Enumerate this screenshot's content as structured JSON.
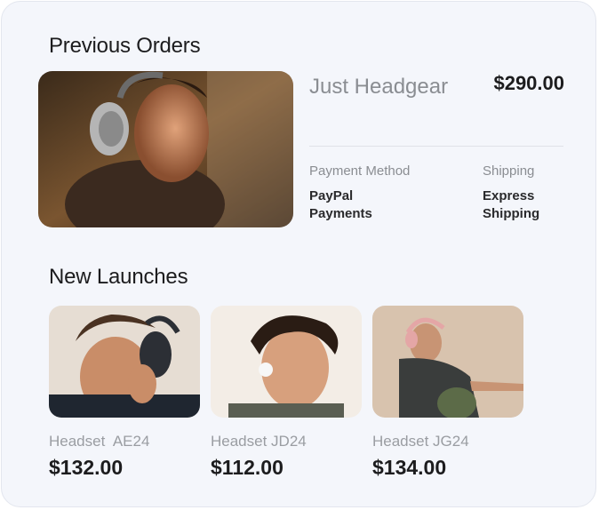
{
  "previous_orders": {
    "title": "Previous Orders",
    "order": {
      "name": "Just Headgear",
      "price": "$290.00",
      "payment_method_label": "Payment Method",
      "payment_method_value": "PayPal Payments",
      "shipping_label": "Shipping",
      "shipping_value": "Express Shipping",
      "image": "person-wearing-silver-headphones"
    }
  },
  "new_launches": {
    "title": "New Launches",
    "products": [
      {
        "name": "Headset  AE24",
        "price": "$132.00",
        "image": "man-with-black-headphones"
      },
      {
        "name": "Headset JD24",
        "price": "$112.00",
        "image": "man-with-white-earbud"
      },
      {
        "name": "Headset JG24",
        "price": "$134.00",
        "image": "woman-with-pink-headphones"
      }
    ]
  },
  "colors": {
    "background": "#f4f6fb",
    "heading": "#1c1c1e",
    "muted": "#8a8d92"
  }
}
